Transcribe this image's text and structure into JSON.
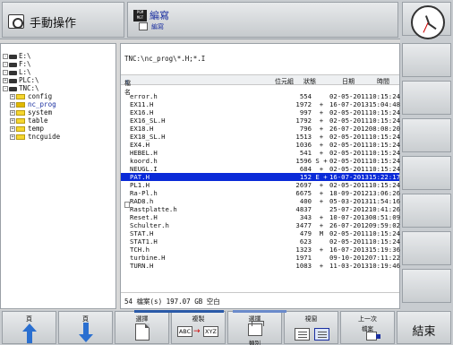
{
  "header": {
    "mode_left_label": "手動操作",
    "mode_right_title": "編寫",
    "mode_right_sub": "編寫",
    "pgm_icon_text": "PGM MGT"
  },
  "tree": {
    "items": [
      {
        "label": "E:\\",
        "type": "drive",
        "expander": "-"
      },
      {
        "label": "F:\\",
        "type": "drive",
        "expander": "-"
      },
      {
        "label": "L:\\",
        "type": "drive",
        "expander": "-"
      },
      {
        "label": "PLC:\\",
        "type": "drive",
        "expander": "+"
      },
      {
        "label": "TNC:\\",
        "type": "drive",
        "expander": "-"
      },
      {
        "label": "config",
        "type": "folder",
        "expander": "+"
      },
      {
        "label": "nc_prog",
        "type": "folder",
        "expander": "+",
        "selected": true
      },
      {
        "label": "system",
        "type": "folder",
        "expander": "+"
      },
      {
        "label": "table",
        "type": "folder",
        "expander": "+"
      },
      {
        "label": "temp",
        "type": "folder",
        "expander": "+"
      },
      {
        "label": "tncguide",
        "type": "folder",
        "expander": "+"
      }
    ]
  },
  "files": {
    "path": "TNC:\\nc_prog\\*.H;*.I",
    "columns": {
      "name": "檔名",
      "size": "位元組",
      "status": "狀態",
      "date": "日期",
      "time": "時間"
    },
    "rows": [
      {
        "name": "error.h",
        "size": "554",
        "status": "",
        "date": "02-05-2011",
        "time": "10:15:24"
      },
      {
        "name": "EX11.H",
        "size": "1972",
        "status": "+",
        "date": "16-07-2013",
        "time": "15:04:48"
      },
      {
        "name": "EX16.H",
        "size": "997",
        "status": "+",
        "date": "02-05-2011",
        "time": "10:15:24"
      },
      {
        "name": "EX16_SL.H",
        "size": "1792",
        "status": "+",
        "date": "02-05-2011",
        "time": "10:15:24"
      },
      {
        "name": "EX18.H",
        "size": "796",
        "status": "+",
        "date": "26-07-2012",
        "time": "08:08:20"
      },
      {
        "name": "EX18_SL.H",
        "size": "1513",
        "status": "+",
        "date": "02-05-2011",
        "time": "10:15:24"
      },
      {
        "name": "EX4.H",
        "size": "1036",
        "status": "+",
        "date": "02-05-2011",
        "time": "10:15:24"
      },
      {
        "name": "HEBEL.H",
        "size": "541",
        "status": "+",
        "date": "02-05-2011",
        "time": "10:15:24"
      },
      {
        "name": "koord.h",
        "size": "1596",
        "status": "S +",
        "date": "02-05-2011",
        "time": "10:15:24"
      },
      {
        "name": "NEUGL.I",
        "size": "684",
        "status": "+",
        "date": "02-05-2011",
        "time": "10:15:24"
      },
      {
        "name": "PAT.H",
        "size": "152",
        "status": "E +",
        "date": "16-07-2013",
        "time": "15:22:17",
        "selected": true
      },
      {
        "name": "PL1.H",
        "size": "2697",
        "status": "+",
        "date": "02-05-2011",
        "time": "10:15:24"
      },
      {
        "name": "Ra-Pl.h",
        "size": "6675",
        "status": "+",
        "date": "18-09-2012",
        "time": "13:06:26"
      },
      {
        "name": "RAD8.h",
        "size": "400",
        "status": "+",
        "date": "05-03-2013",
        "time": "11:54:16"
      },
      {
        "name": "Rastplatte.h",
        "size": "4837",
        "status": "",
        "date": "25-07-2012",
        "time": "10:41:26"
      },
      {
        "name": "Reset.H",
        "size": "343",
        "status": "+",
        "date": "10-07-2013",
        "time": "08:51:09"
      },
      {
        "name": "Schulter.h",
        "size": "3477",
        "status": "+",
        "date": "26-07-2012",
        "time": "09:59:02"
      },
      {
        "name": "STAT.H",
        "size": "479",
        "status": "M",
        "date": "02-05-2011",
        "time": "10:15:24"
      },
      {
        "name": "STAT1.H",
        "size": "623",
        "status": "",
        "date": "02-05-2011",
        "time": "10:15:24"
      },
      {
        "name": "TCH.h",
        "size": "1323",
        "status": "+",
        "date": "16-07-2013",
        "time": "15:19:36"
      },
      {
        "name": "turbine.H",
        "size": "1971",
        "status": "",
        "date": "09-10-2012",
        "time": "07:11:22"
      },
      {
        "name": "TURN.H",
        "size": "1083",
        "status": "+",
        "date": "11-03-2013",
        "time": "10:19:46"
      }
    ],
    "footer": "54  檔案(s) 197.07 GB 空白"
  },
  "softkeys": {
    "page_up": "頁",
    "page_down": "頁",
    "select": "選擇",
    "copy": "複製",
    "copy_from": "ABC",
    "copy_to": "XYZ",
    "select_type": "選擇",
    "select_type_sub": "類別",
    "window": "視窗",
    "last_file": "上一次",
    "last_file_sub": "檔案",
    "end": "結束"
  }
}
